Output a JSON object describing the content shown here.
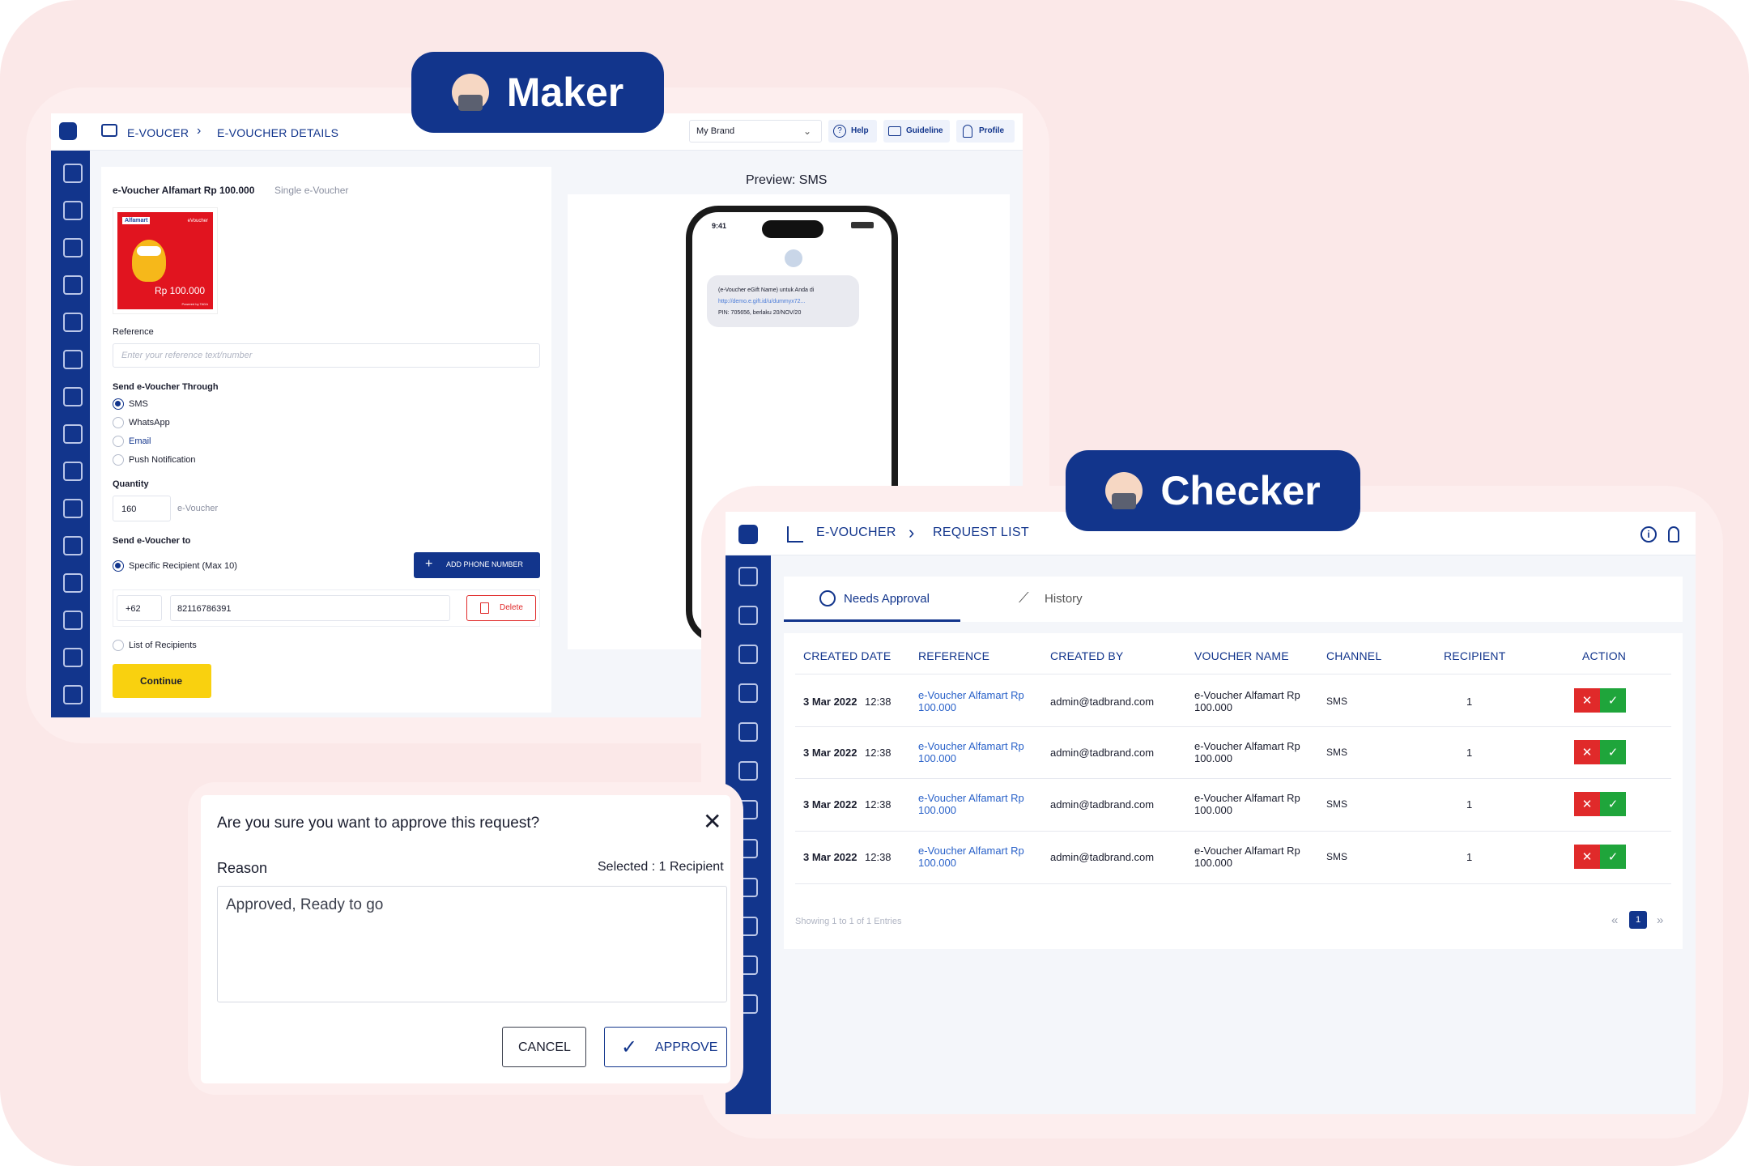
{
  "badges": {
    "maker": "Maker",
    "checker": "Checker"
  },
  "maker": {
    "breadcrumb": {
      "section": "E-VOUCER",
      "page": "E-VOUCHER DETAILS"
    },
    "brand_select": "My Brand",
    "header_buttons": {
      "help": "Help",
      "guideline": "Guideline",
      "profile": "Profile"
    },
    "voucher_title": "e-Voucher Alfamart Rp 100.000",
    "voucher_type": "Single e-Voucher",
    "voucher_image": {
      "brand": "Alfamart",
      "tag": "eVoucher",
      "amount": "Rp 100.000",
      "powered": "Powered by TADA"
    },
    "reference_label": "Reference",
    "reference_placeholder": "Enter your reference text/number",
    "send_through_label": "Send e-Voucher Through",
    "channels": [
      {
        "label": "SMS",
        "selected": true
      },
      {
        "label": "WhatsApp",
        "selected": false
      },
      {
        "label": "Email",
        "selected": false
      },
      {
        "label": "Push Notification",
        "selected": false
      }
    ],
    "quantity_label": "Quantity",
    "quantity_value": "160",
    "quantity_unit": "e-Voucher",
    "send_to_label": "Send e-Voucher to",
    "specific_recipient": "Specific Recipient (Max 10)",
    "add_phone_button": "ADD PHONE NUMBER",
    "country_code": "+62",
    "phone_number": "82116786391",
    "delete_button": "Delete",
    "list_recipients": "List of Recipients",
    "continue_button": "Continue",
    "preview_title": "Preview: SMS",
    "phone": {
      "time": "9:41",
      "sms_line1": "(e-Voucher eGift Name) untuk Anda di",
      "sms_link": "http://demo.e.gift.id/u/dummyx72...",
      "sms_line3": "PIN: 705656, berlaku 20/NOV/20"
    }
  },
  "checker": {
    "breadcrumb": {
      "section": "E-VOUCHER",
      "page": "REQUEST LIST"
    },
    "tabs": [
      {
        "label": "Needs Approval",
        "active": true
      },
      {
        "label": "History",
        "active": false
      }
    ],
    "columns": [
      "CREATED DATE",
      "REFERENCE",
      "CREATED BY",
      "VOUCHER NAME",
      "CHANNEL",
      "RECIPIENT",
      "ACTION"
    ],
    "rows": [
      {
        "date": "3 Mar 2022",
        "time": "12:38",
        "reference": "e-Voucher Alfamart Rp 100.000",
        "created_by": "admin@tadbrand.com",
        "voucher_name": "e-Voucher Alfamart Rp 100.000",
        "channel": "SMS",
        "recipient": "1"
      },
      {
        "date": "3 Mar 2022",
        "time": "12:38",
        "reference": "e-Voucher Alfamart Rp 100.000",
        "created_by": "admin@tadbrand.com",
        "voucher_name": "e-Voucher Alfamart Rp 100.000",
        "channel": "SMS",
        "recipient": "1"
      },
      {
        "date": "3 Mar 2022",
        "time": "12:38",
        "reference": "e-Voucher Alfamart Rp 100.000",
        "created_by": "admin@tadbrand.com",
        "voucher_name": "e-Voucher Alfamart Rp 100.000",
        "channel": "SMS",
        "recipient": "1"
      },
      {
        "date": "3 Mar 2022",
        "time": "12:38",
        "reference": "e-Voucher Alfamart Rp 100.000",
        "created_by": "admin@tadbrand.com",
        "voucher_name": "e-Voucher Alfamart Rp 100.000",
        "channel": "SMS",
        "recipient": "1"
      }
    ],
    "pagination_info": "Showing 1 to 1 of 1 Entries",
    "current_page": "1",
    "reject_symbol": "✕",
    "accept_symbol": "✓"
  },
  "dialog": {
    "title": "Are you sure you want to approve this request?",
    "reason_label": "Reason",
    "selected_info": "Selected : 1 Recipient",
    "reason_value": "Approved, Ready to go",
    "cancel_button": "CANCEL",
    "approve_button": "APPROVE"
  },
  "colors": {
    "primary": "#12358c",
    "accent_yellow": "#f9d10f",
    "reject": "#e02a2a",
    "accept": "#1fa53b",
    "link": "#2a62c9",
    "background": "#fbe8e8"
  }
}
